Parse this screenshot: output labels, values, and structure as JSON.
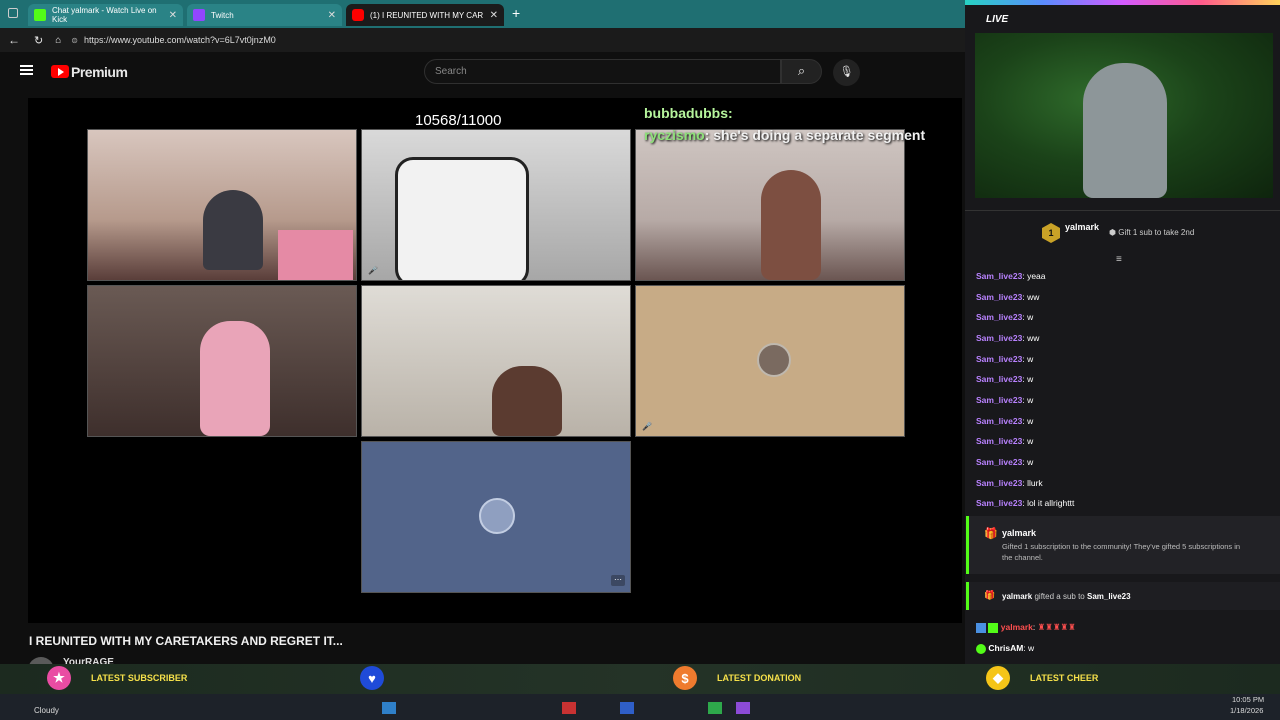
{
  "tabs": [
    {
      "title": "Chat yalmark - Watch Live on Kick",
      "color": "#53fc18"
    },
    {
      "title": "Twitch",
      "color": "#9146ff"
    },
    {
      "title": "(1) I REUNITED WITH MY CAR",
      "color": "#ff0000"
    }
  ],
  "address": {
    "url": "https://www.youtube.com/watch?v=6L7vt0jnzM0"
  },
  "youtube": {
    "logo": "Premium",
    "search_placeholder": "Search"
  },
  "video": {
    "counter": "10568/11000",
    "overlay_user": "bubbadubbs:",
    "overlay_user2": "ryczismo",
    "overlay_msg": ": she's doing a separate segment",
    "title": "I REUNITED WITH MY CARETAKERS AND REGRET IT...",
    "channel": "YourRAGE"
  },
  "stream": {
    "live_label": "LIVE"
  },
  "pinned": {
    "user": "yalmark",
    "badge": "1",
    "gift_text": "Gift 1 sub to take 2nd"
  },
  "chat": [
    {
      "user": "Sam_live23",
      "msg": "yeaa"
    },
    {
      "user": "Sam_live23",
      "msg": "ww"
    },
    {
      "user": "Sam_live23",
      "msg": "w"
    },
    {
      "user": "Sam_live23",
      "msg": "ww"
    },
    {
      "user": "Sam_live23",
      "msg": "w"
    },
    {
      "user": "Sam_live23",
      "msg": "w"
    },
    {
      "user": "Sam_live23",
      "msg": "w"
    },
    {
      "user": "Sam_live23",
      "msg": "w"
    },
    {
      "user": "Sam_live23",
      "msg": "w"
    },
    {
      "user": "Sam_live23",
      "msg": "w"
    },
    {
      "user": "Sam_live23",
      "msg": "llurk"
    },
    {
      "user": "Sam_live23",
      "msg": "lol it allrighttt"
    }
  ],
  "gift_event": {
    "user": "yalmark",
    "text": "Gifted 1 subscription to the community! They've gifted 5 subscriptions in the channel."
  },
  "gift_sub": {
    "user": "yalmark",
    "text": "gifted a sub to",
    "target": "Sam_live23"
  },
  "chat_tail": [
    {
      "user": "yalmark",
      "msg": ": ",
      "color": "#ff4f4f"
    },
    {
      "user": "ChrisAM",
      "msg": ": w",
      "color": "#ffffff"
    }
  ],
  "overlay": {
    "latest_subscriber": "LATEST SUBSCRIBER",
    "latest_donation": "LATEST DONATION",
    "latest_cheer": "LATEST CHEER"
  },
  "taskbar": {
    "weather": "Cloudy",
    "time": "10:05 PM",
    "date": "1/18/2026"
  }
}
